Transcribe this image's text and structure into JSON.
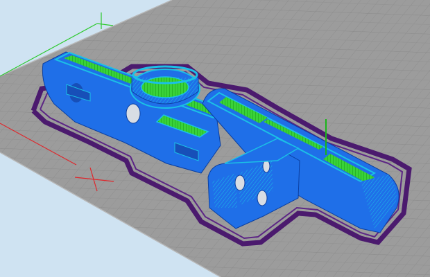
{
  "viewport": {
    "name": "slicer-layer-preview",
    "colors": {
      "background": "#cfe3f2",
      "bed": "#9c9c9c",
      "grid_line": "#8a8a8a",
      "bed_edge": "#b7b7b7",
      "part_fill": "#1f6fe8",
      "part_edge": "#0b3fa0",
      "infill": "#39d239",
      "infill_hatch": "#1fa81f",
      "perimeter_highlight": "#1bc0e6",
      "brim": "#4b1a6e",
      "x_axis": "#e0262b",
      "y_axis": "#2cc92c",
      "z_axis": "#19b519"
    }
  }
}
